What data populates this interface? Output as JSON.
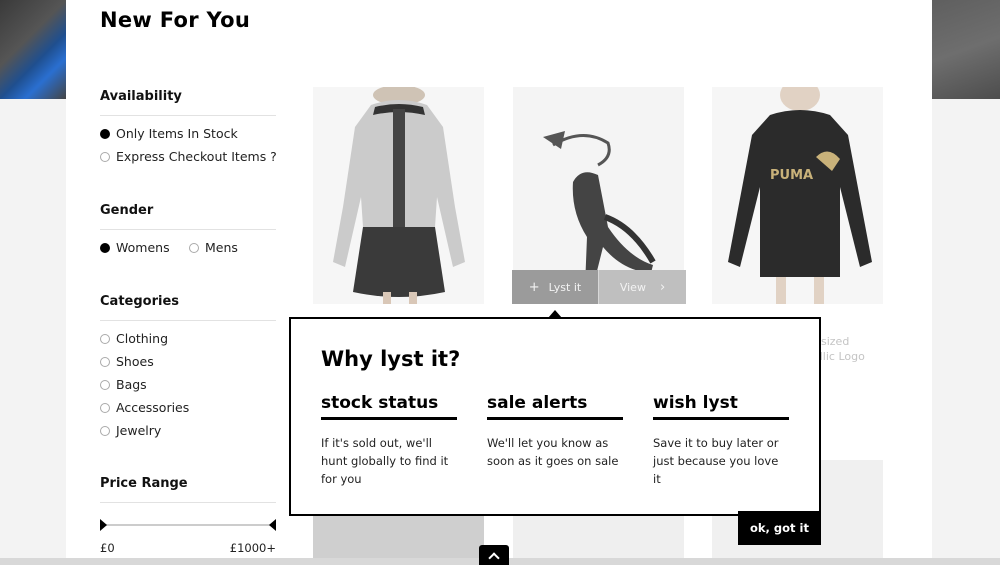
{
  "page": {
    "title": "New For You"
  },
  "filters": {
    "availability": {
      "heading": "Availability",
      "options": [
        "Only Items In Stock",
        "Express Checkout Items ?"
      ],
      "selected": "Only Items In Stock"
    },
    "gender": {
      "heading": "Gender",
      "options": [
        "Womens",
        "Mens"
      ],
      "selected": "Womens"
    },
    "categories": {
      "heading": "Categories",
      "options": [
        "Clothing",
        "Shoes",
        "Bags",
        "Accessories",
        "Jewelry"
      ]
    },
    "price_range": {
      "heading": "Price Range",
      "min_label": "£0",
      "max_label": "£1000+"
    }
  },
  "product_actions": {
    "lyst_label": "Lyst it",
    "view_label": "View"
  },
  "faded_product_text": [
    "sized",
    "allic Logo"
  ],
  "popover": {
    "title": "Why lyst it?",
    "columns": [
      {
        "heading": "stock status",
        "text": "If it's sold out, we'll hunt globally to find it for you"
      },
      {
        "heading": "sale alerts",
        "text": "We'll let you know as soon as it goes on sale"
      },
      {
        "heading": "wish lyst",
        "text": "Save it to buy later or just because you love it"
      }
    ],
    "ok_label": "ok, got it"
  },
  "icons": {
    "plus": "plus-icon",
    "chevron": "chevron-right-icon",
    "scroll_top": "chevron-up-icon"
  },
  "colors": {
    "accent": "#000000",
    "overlay_button": "#9b9b9b"
  }
}
